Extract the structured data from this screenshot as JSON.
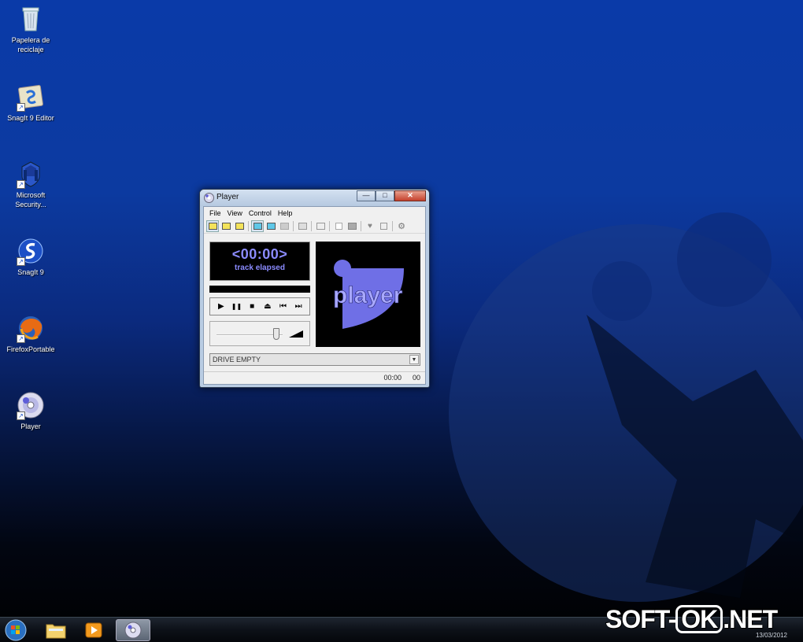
{
  "desktop": {
    "icons": [
      {
        "label": "Papelera de reciclaje",
        "icon": "recycle-bin-icon"
      },
      {
        "label": "SnagIt 9 Editor",
        "icon": "snagit-editor-icon"
      },
      {
        "label": "Microsoft Security...",
        "icon": "microsoft-security-icon"
      },
      {
        "label": "SnagIt 9",
        "icon": "snagit-icon"
      },
      {
        "label": "FirefoxPortable",
        "icon": "firefox-icon"
      },
      {
        "label": "Player",
        "icon": "player-cd-icon"
      }
    ]
  },
  "window": {
    "title": "Player",
    "minimize": "—",
    "maximize": "□",
    "close": "✕",
    "menu": [
      "File",
      "View",
      "Control",
      "Help"
    ],
    "display": {
      "time": "<00:00>",
      "label": "track elapsed"
    },
    "controls": [
      {
        "name": "play-button",
        "glyph": "▶"
      },
      {
        "name": "pause-button",
        "glyph": "❚❚"
      },
      {
        "name": "stop-button",
        "glyph": "■"
      },
      {
        "name": "eject-button",
        "glyph": "⏏"
      },
      {
        "name": "previous-track-button",
        "glyph": "⏮"
      },
      {
        "name": "next-track-button",
        "glyph": "⏭"
      }
    ],
    "logo_text": "player",
    "drive_select": "DRIVE EMPTY",
    "status": {
      "time": "00:00",
      "track": "00"
    }
  },
  "taskbar": {
    "clock_date": "13/03/2012"
  },
  "watermark": {
    "left": "SOFT-",
    "ok": "OK",
    "right": ".NET"
  },
  "colors": {
    "display_text": "#8b8bff",
    "logo_purple": "#6f6fe6",
    "desktop_blue": "#0a3aa8"
  }
}
